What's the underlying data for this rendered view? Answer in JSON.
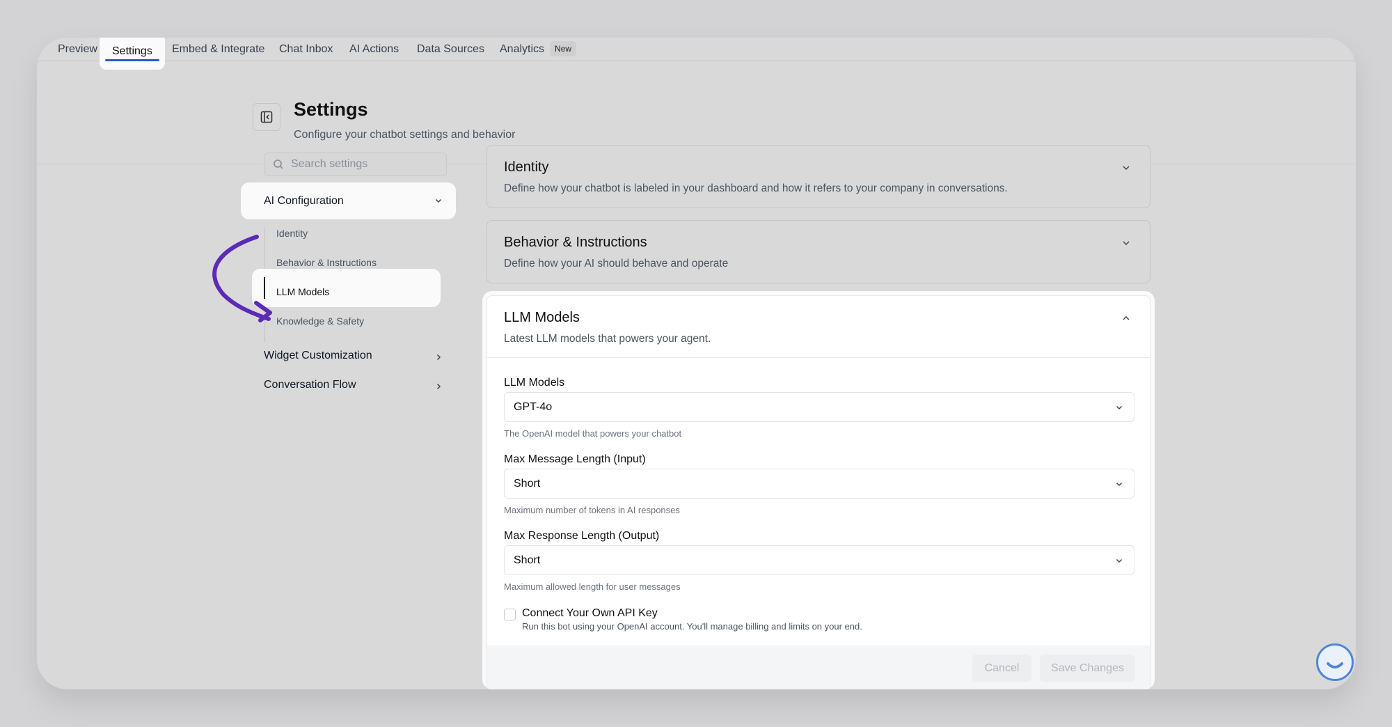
{
  "nav": {
    "tabs": [
      {
        "label": "Preview"
      },
      {
        "label": "Settings"
      },
      {
        "label": "Embed & Integrate"
      },
      {
        "label": "Chat Inbox"
      },
      {
        "label": "AI Actions"
      },
      {
        "label": "Data Sources"
      },
      {
        "label": "Analytics"
      }
    ],
    "analytics_badge": "New"
  },
  "header": {
    "title": "Settings",
    "subtitle": "Configure your chatbot settings and behavior"
  },
  "sidebar": {
    "search_placeholder": "Search settings",
    "ai_configuration": "AI Configuration",
    "sub_items": [
      "Identity",
      "Behavior & Instructions",
      "LLM Models",
      "Knowledge & Safety"
    ],
    "widget_customization": "Widget Customization",
    "conversation_flow": "Conversation Flow"
  },
  "cards": {
    "identity": {
      "title": "Identity",
      "subtitle": "Define how your chatbot is labeled in your dashboard and how it refers to your company in conversations."
    },
    "behavior": {
      "title": "Behavior & Instructions",
      "subtitle": "Define how your AI should behave and operate"
    },
    "llm": {
      "title": "LLM Models",
      "subtitle": "Latest LLM models that powers your agent.",
      "fields": {
        "model_label": "LLM Models",
        "model_value": "GPT-4o",
        "model_hint": "The OpenAI model that powers your chatbot",
        "input_label": "Max Message Length (Input)",
        "input_value": "Short",
        "input_hint": "Maximum number of tokens in AI responses",
        "output_label": "Max Response Length (Output)",
        "output_value": "Short",
        "output_hint": "Maximum allowed length for user messages",
        "api_key_label": "Connect Your Own API Key",
        "api_key_hint": "Run this bot using your OpenAI account. You'll manage billing and limits on your end."
      },
      "buttons": {
        "cancel": "Cancel",
        "save": "Save Changes"
      }
    }
  },
  "colors": {
    "annotation_arrow": "#5b2bb5",
    "active_tab_underline": "#2b5bc5",
    "chat_widget": "#4f86d6"
  }
}
